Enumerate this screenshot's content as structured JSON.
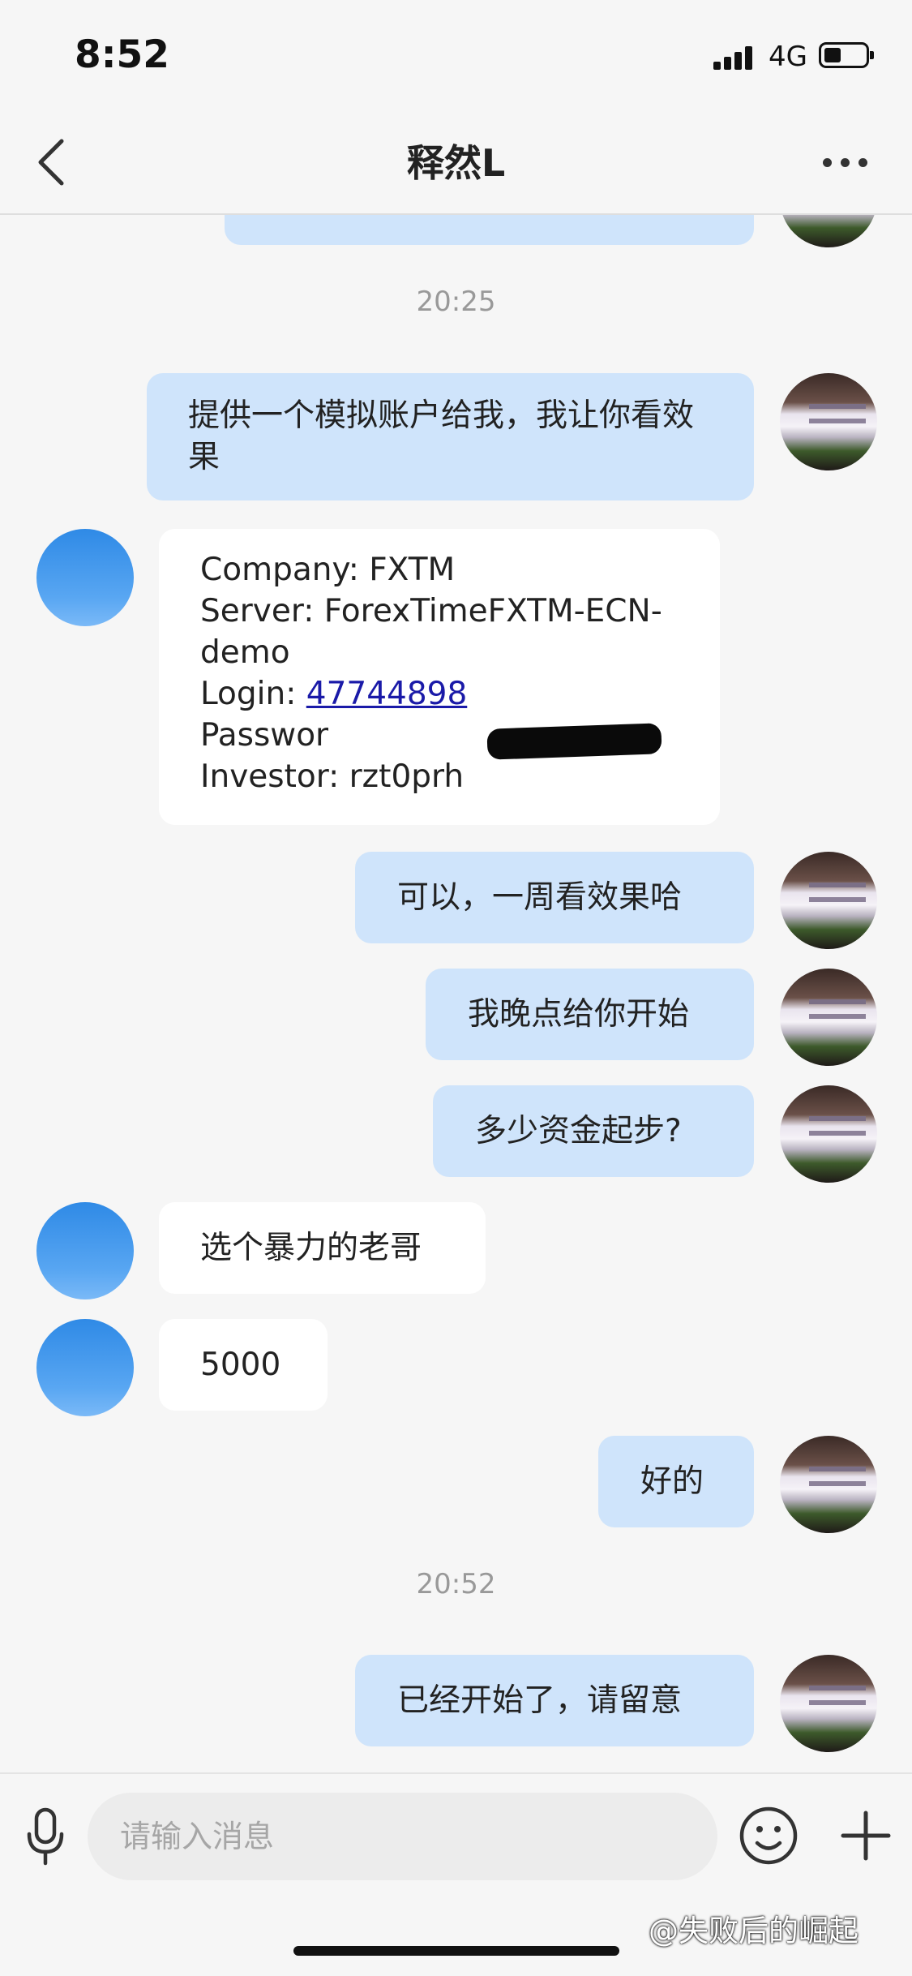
{
  "status_bar": {
    "time": "8:52",
    "network": "4G"
  },
  "header": {
    "title": "释然L"
  },
  "messages": {
    "ts1": "20:25",
    "m1": "提供一个模拟账户给我，我让你看效果",
    "account": {
      "company": "Company: FXTM",
      "server": "Server: ForexTimeFXTM-ECN-demo",
      "login_label": "Login: ",
      "login_value": "47744898",
      "password": "Passwor",
      "investor": "Investor: rzt0prh"
    },
    "m3": "可以，一周看效果哈",
    "m4": "我晚点给你开始",
    "m5": "多少资金起步?",
    "m6": "选个暴力的老哥",
    "m7": "5000",
    "m8": "好的",
    "ts2": "20:52",
    "m9": "已经开始了，请留意"
  },
  "input": {
    "placeholder": "请输入消息"
  },
  "watermark": "@失败后的崛起",
  "colors": {
    "outgoing_bubble": "#cfe4fb",
    "incoming_bubble": "#ffffff",
    "background": "#f6f6f6"
  }
}
